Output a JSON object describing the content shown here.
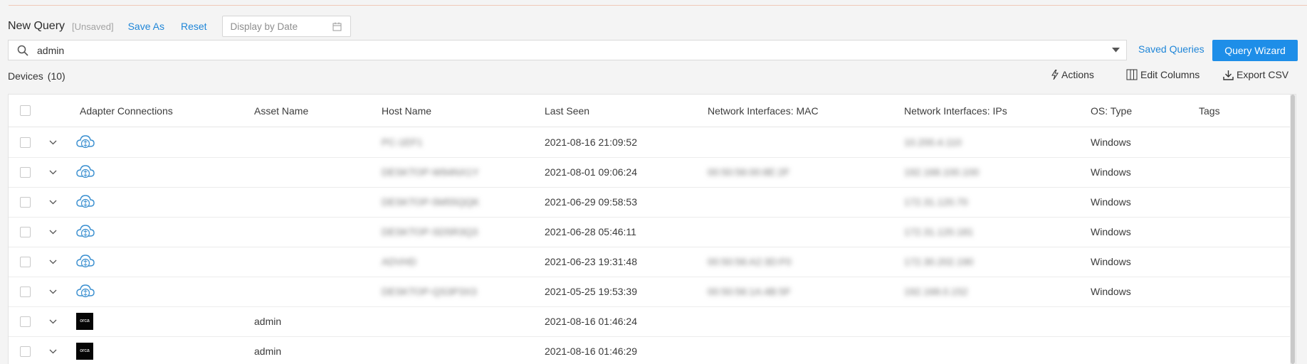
{
  "query": {
    "title": "New Query",
    "status": "[Unsaved]",
    "save_as": "Save As",
    "reset": "Reset",
    "date_placeholder": "Display by Date"
  },
  "search": {
    "value": "admin"
  },
  "saved_queries": "Saved Queries",
  "query_wizard": "Query Wizard",
  "devices": {
    "label": "Devices",
    "count": "(10)"
  },
  "toolbar": {
    "actions": "Actions",
    "edit_columns": "Edit Columns",
    "export_csv": "Export CSV"
  },
  "table": {
    "columns": [
      "Adapter Connections",
      "Asset Name",
      "Host Name",
      "Last Seen",
      "Network Interfaces: MAC",
      "Network Interfaces: IPs",
      "OS: Type",
      "Tags"
    ],
    "rows": [
      {
        "adapter": "cloud-adapter-icon",
        "asset": "",
        "host": "PC-1EF1",
        "last_seen": "2021-08-16 21:09:52",
        "mac": "",
        "ips": "10.200.4.110",
        "os": "Windows"
      },
      {
        "adapter": "cloud-adapter-icon",
        "asset": "",
        "host": "DESKTOP-W94NX1Y",
        "last_seen": "2021-08-01 09:06:24",
        "mac": "00:50:56:00:8E:2F",
        "ips": "192.168.100.100",
        "os": "Windows"
      },
      {
        "adapter": "cloud-adapter-icon",
        "asset": "",
        "host": "DESKTOP-5M55QQK",
        "last_seen": "2021-06-29 09:58:53",
        "mac": "",
        "ips": "172.31.120.70",
        "os": "Windows"
      },
      {
        "adapter": "cloud-adapter-icon",
        "asset": "",
        "host": "DESKTOP-SD5R3Q3",
        "last_seen": "2021-06-28 05:46:11",
        "mac": "",
        "ips": "172.31.120.181",
        "os": "Windows"
      },
      {
        "adapter": "cloud-adapter-icon",
        "asset": "",
        "host": "ADVHD",
        "last_seen": "2021-06-23 19:31:48",
        "mac": "00:50:56:A2:3D:F0",
        "ips": "172.30.202.190",
        "os": "Windows"
      },
      {
        "adapter": "cloud-adapter-icon",
        "asset": "",
        "host": "DESKTOP-QS3P3X3",
        "last_seen": "2021-05-25 19:53:39",
        "mac": "00:50:56:1A:4B:5F",
        "ips": "192.168.0.152",
        "os": "Windows"
      },
      {
        "adapter": "black-logo",
        "logo_text": "orca",
        "asset": "admin",
        "host": "",
        "last_seen": "2021-08-16 01:46:24",
        "mac": "",
        "ips": "",
        "os": ""
      },
      {
        "adapter": "black-logo",
        "logo_text": "orca",
        "asset": "admin",
        "host": "",
        "last_seen": "2021-08-16 01:46:29",
        "mac": "",
        "ips": "",
        "os": ""
      }
    ]
  },
  "colors": {
    "accent": "#1e8ee8",
    "link": "#1f86d8"
  }
}
